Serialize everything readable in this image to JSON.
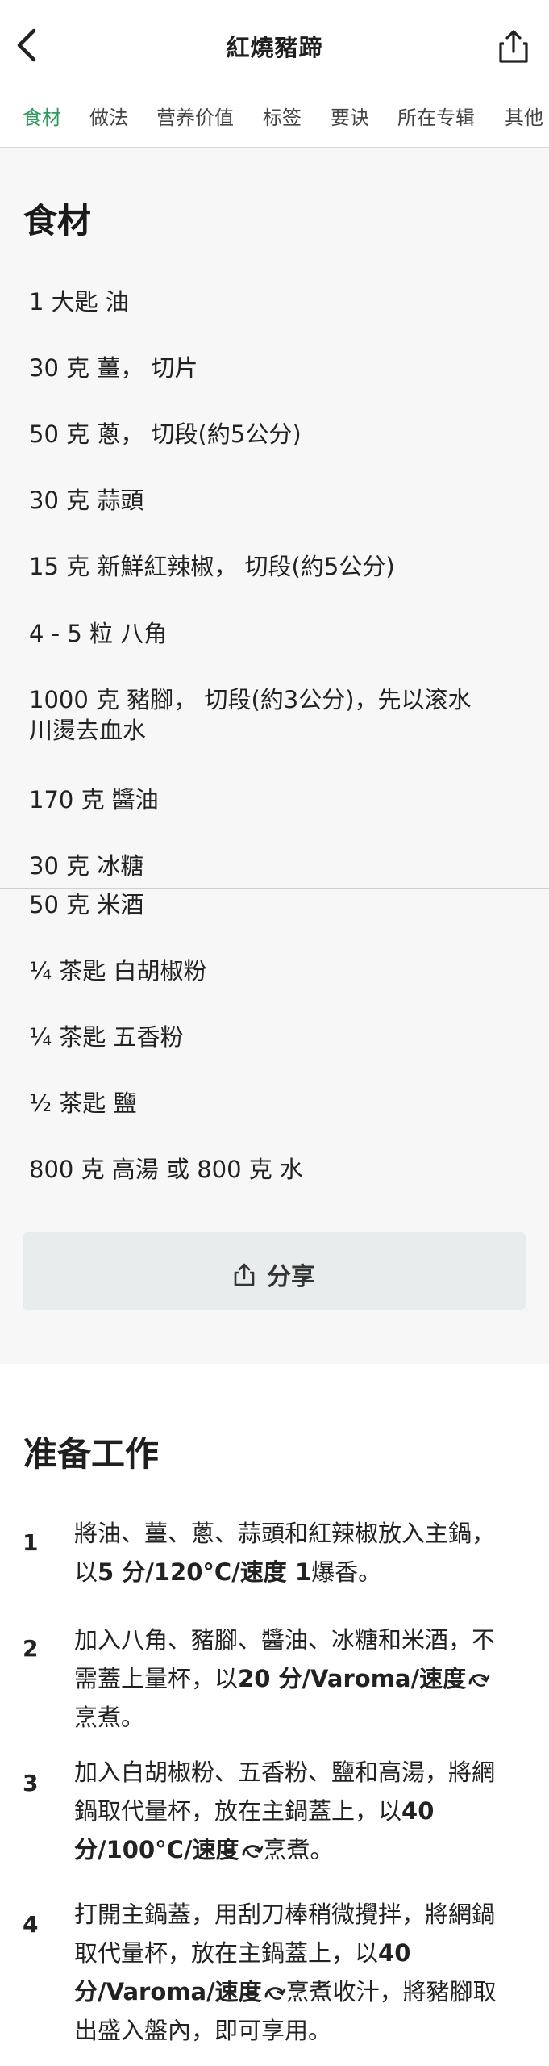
{
  "header": {
    "title": "紅燒豬蹄",
    "back_icon": "back-chevron-icon",
    "share_icon": "share-icon"
  },
  "tabs": [
    {
      "label": "食材",
      "active": true
    },
    {
      "label": "做法"
    },
    {
      "label": "营养价值"
    },
    {
      "label": "标签"
    },
    {
      "label": "要诀"
    },
    {
      "label": "所在专辑"
    },
    {
      "label": "其他"
    }
  ],
  "ingredients": {
    "title": "食材",
    "items": [
      "1 大匙 油",
      "30 克 薑， 切片",
      "50 克 蔥， 切段(約5公分)",
      "30 克 蒜頭",
      "15 克 新鮮紅辣椒， 切段(約5公分)",
      "4 - 5 粒 八角",
      "1000 克 豬腳， 切段(約3公分)，先以滚水川燙去血水",
      "170 克 醬油",
      "30 克 冰糖",
      "50 克 米酒",
      "¼ 茶匙 白胡椒粉",
      "¼ 茶匙 五香粉",
      "½ 茶匙 鹽",
      "800 克 高湯 或 800 克 水"
    ]
  },
  "share_button": {
    "label": "分享",
    "icon": "share-icon"
  },
  "prep": {
    "title": "准备工作",
    "steps": [
      {
        "num": "1",
        "a": "將油、薑、蔥、蒜頭和紅辣椒放入主鍋，以",
        "b": "5 分/120°C/速度 1",
        "c": "爆香。"
      },
      {
        "num": "2",
        "a": "加入八角、豬腳、醬油、冰糖和米酒，不需蓋上量杯，以",
        "b": "20 分/Varoma/速度",
        "c": "烹煮。"
      },
      {
        "num": "3",
        "a": "加入白胡椒粉、五香粉、鹽和高湯，將網鍋取代量杯，放在主鍋蓋上，以",
        "b": "40 分/100°C/速度",
        "c": "烹煮。"
      },
      {
        "num": "4",
        "a": "打開主鍋蓋，用刮刀棒稍微攪拌，將網鍋取代量杯，放在主鍋蓋上，以",
        "b": "40 分/Varoma/速度",
        "c": "烹煮收汁，將豬腳取出盛入盤內，即可享用。"
      }
    ]
  },
  "colors": {
    "accent": "#2a9d5c",
    "section_bg": "#f7f7f7",
    "button_bg": "#e9ecec"
  }
}
